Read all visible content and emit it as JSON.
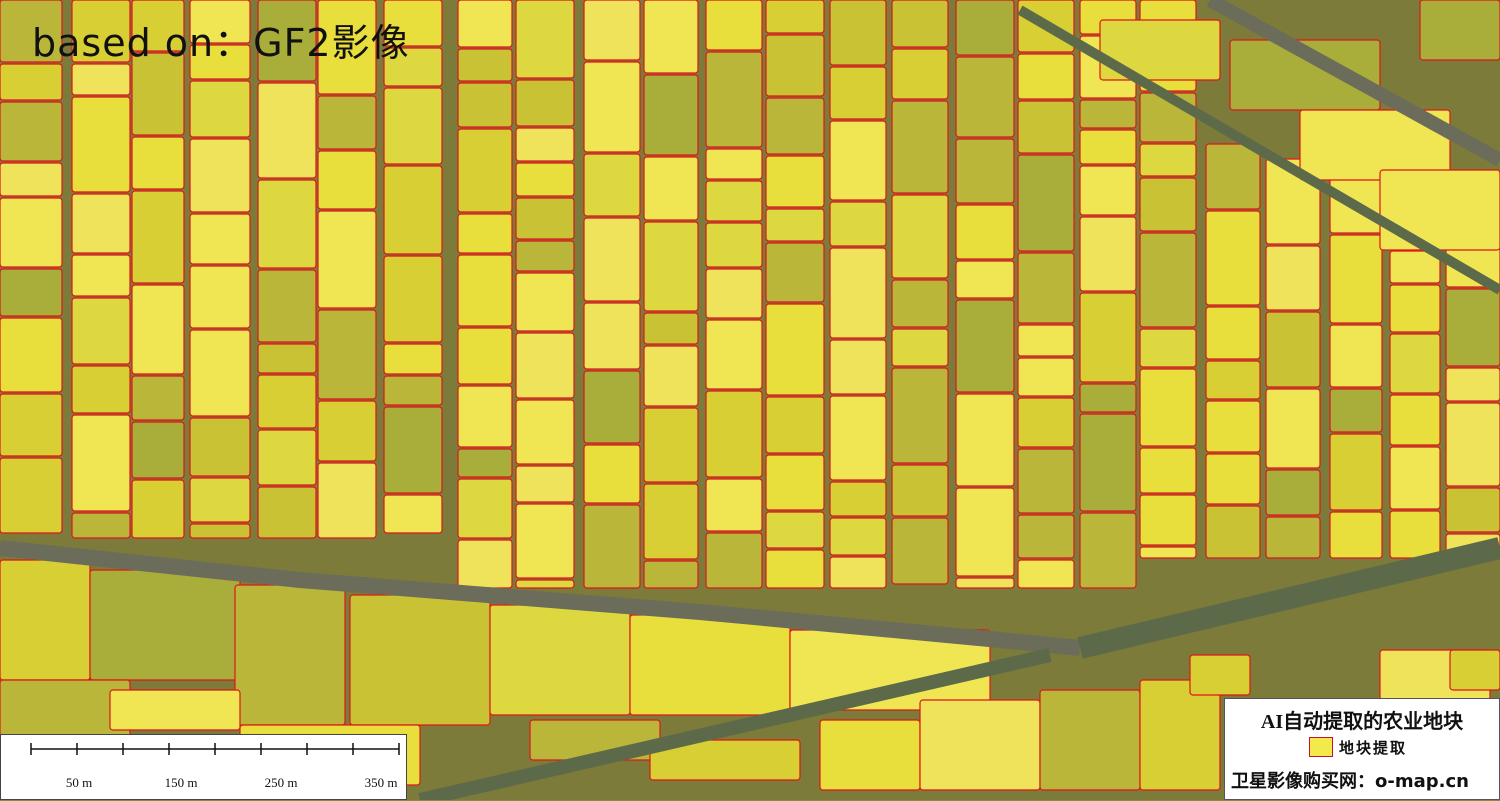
{
  "source_label": "based on：GF2影像",
  "legend": {
    "title": "AI自动提取的农业地块",
    "item_label": "地块提取",
    "colors": {
      "field_fill": "#f2ea4a",
      "field_outline": "#e0151b"
    }
  },
  "watermark": "卫星影像购买网：o-map.cn",
  "scale_bar": {
    "unit": "m",
    "labels": [
      "50 m",
      "150 m",
      "250 m",
      "350 m"
    ]
  },
  "icons": {
    "legend_swatch": "square-swatch-icon"
  }
}
